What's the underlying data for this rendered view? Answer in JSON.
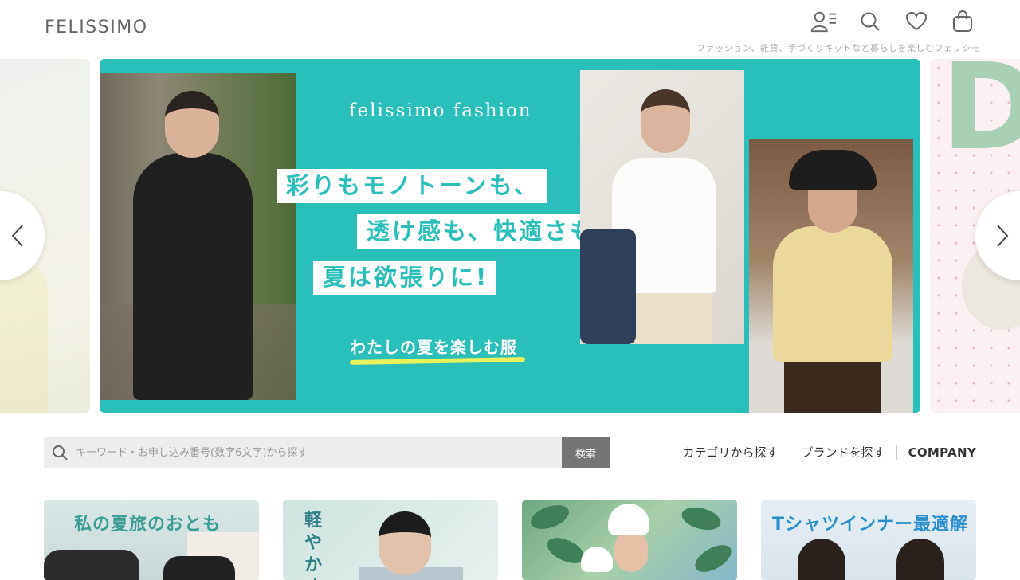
{
  "header": {
    "logo": "FELISSIMO",
    "tagline": "ファッション、雑貨、手づくりキットなど暮らしを楽しむフェリシモ",
    "icons": [
      "account-menu-icon",
      "search-icon",
      "heart-icon",
      "cart-bag-icon"
    ]
  },
  "hero": {
    "brand": "felissimo fashion",
    "copy_line1": "彩りもモノトーンも、",
    "copy_line2": "透け感も、快適さも。",
    "copy_line3": "夏は欲張りに!",
    "sub_copy": "わたしの夏を楽しむ服",
    "next_slide_letter": "D",
    "accent_color": "#2bbfb9",
    "highlight_color": "#e8f05a"
  },
  "search": {
    "placeholder": "キーワード・お申し込み番号(数字6文字)から探す",
    "value": "",
    "button": "検索"
  },
  "nav": {
    "categories": "カテゴリから探す",
    "brands": "ブランドを探す",
    "company": "COMPANY"
  },
  "cards": {
    "card1_title": "私の夏旅のおとも",
    "card2_title": "軽やかオ",
    "card4_title": "Tシャツインナー最適解"
  }
}
